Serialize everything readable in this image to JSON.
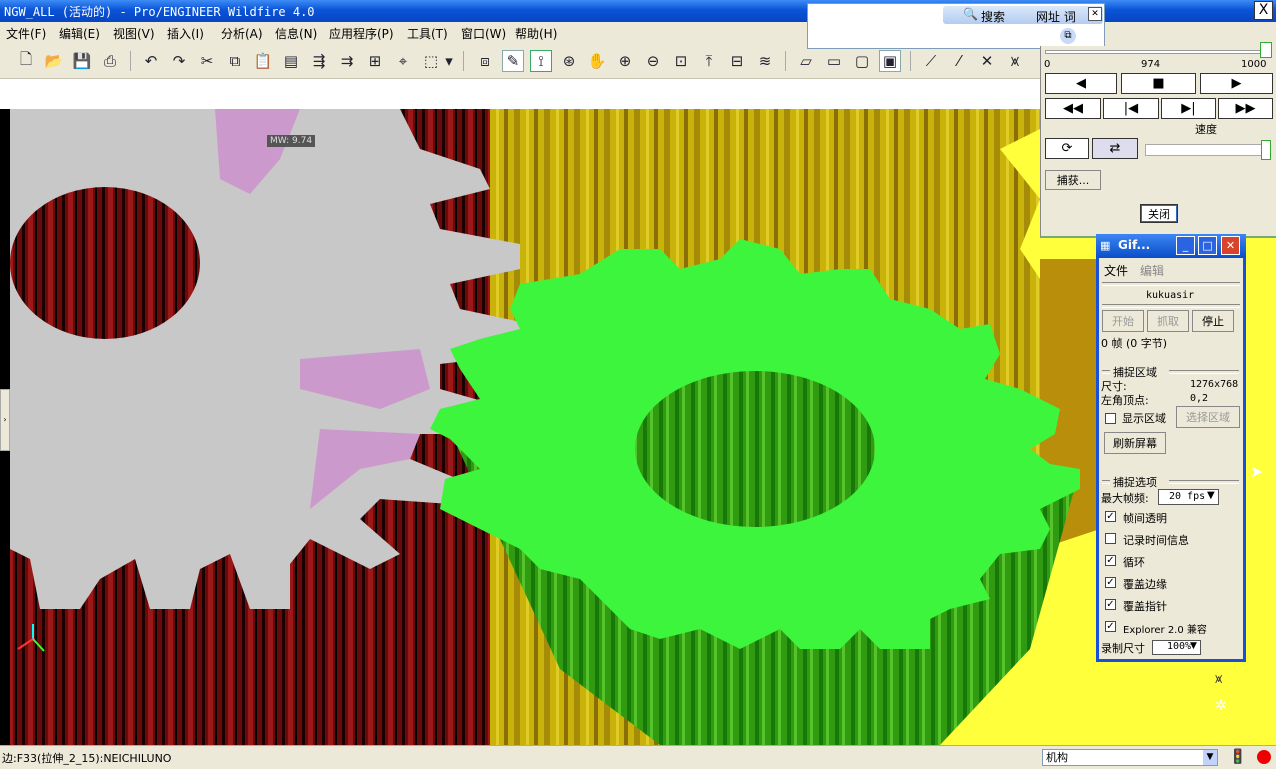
{
  "window": {
    "title": "NGW_ALL (活动的) - Pro/ENGINEER Wildfire 4.0",
    "close": "X"
  },
  "menu": [
    "文件(F)",
    "编辑(E)",
    "视图(V)",
    "插入(I)",
    "分析(A)",
    "信息(N)",
    "应用程序(P)",
    "工具(T)",
    "窗口(W)",
    "帮助(H)"
  ],
  "search_popup": {
    "search_label": "搜索",
    "url_label": "网址 词",
    "close": "✕"
  },
  "graphics": {
    "measure_label": "MW: 9.74"
  },
  "animation": {
    "timeline_min": "0",
    "timeline_mid": "974",
    "timeline_max": "1000",
    "speed_label": "速度",
    "capture_button": "捕获...",
    "close_button": "关闭"
  },
  "gif_dialog": {
    "title": "Gif...",
    "menu_file": "文件",
    "menu_edit": "编辑",
    "username": "kukuasir",
    "btn_start": "开始",
    "btn_grab": "抓取",
    "btn_stop": "停止",
    "frames_text": "0 帧 (0 字节)",
    "region_section": "捕捉区域",
    "size_label": "尺寸:",
    "size_value": "1276x768",
    "corner_label": "左角顶点:",
    "corner_value": "0,2",
    "show_region": "显示区域",
    "select_region": "选择区域",
    "refresh_screen": "刷新屏幕",
    "options_section": "捕捉选项",
    "max_fps_label": "最大帧频:",
    "max_fps_value": "20 fps",
    "options": [
      {
        "label": "帧间透明",
        "checked": "✓"
      },
      {
        "label": "记录时间信息",
        "checked": ""
      },
      {
        "label": "循环",
        "checked": "✓"
      },
      {
        "label": "覆盖边缘",
        "checked": "✓"
      },
      {
        "label": "覆盖指针",
        "checked": "✓"
      },
      {
        "label": "Explorer 2.0 兼容",
        "checked": "✓"
      }
    ],
    "record_size_label": "录制尺寸",
    "record_size_value": "100%"
  },
  "status": {
    "text": "边:F33(拉伸_2_15):NEICHILUNO",
    "filter": "机构"
  },
  "colors": {
    "title_blue": "#0a54d8",
    "gear_green": "#3cf53c",
    "gear_yellow": "#ffff3c",
    "gear_gray": "#c8c8c8",
    "gear_pink": "#f7c4c4",
    "gear_purple": "#cc99cc"
  }
}
